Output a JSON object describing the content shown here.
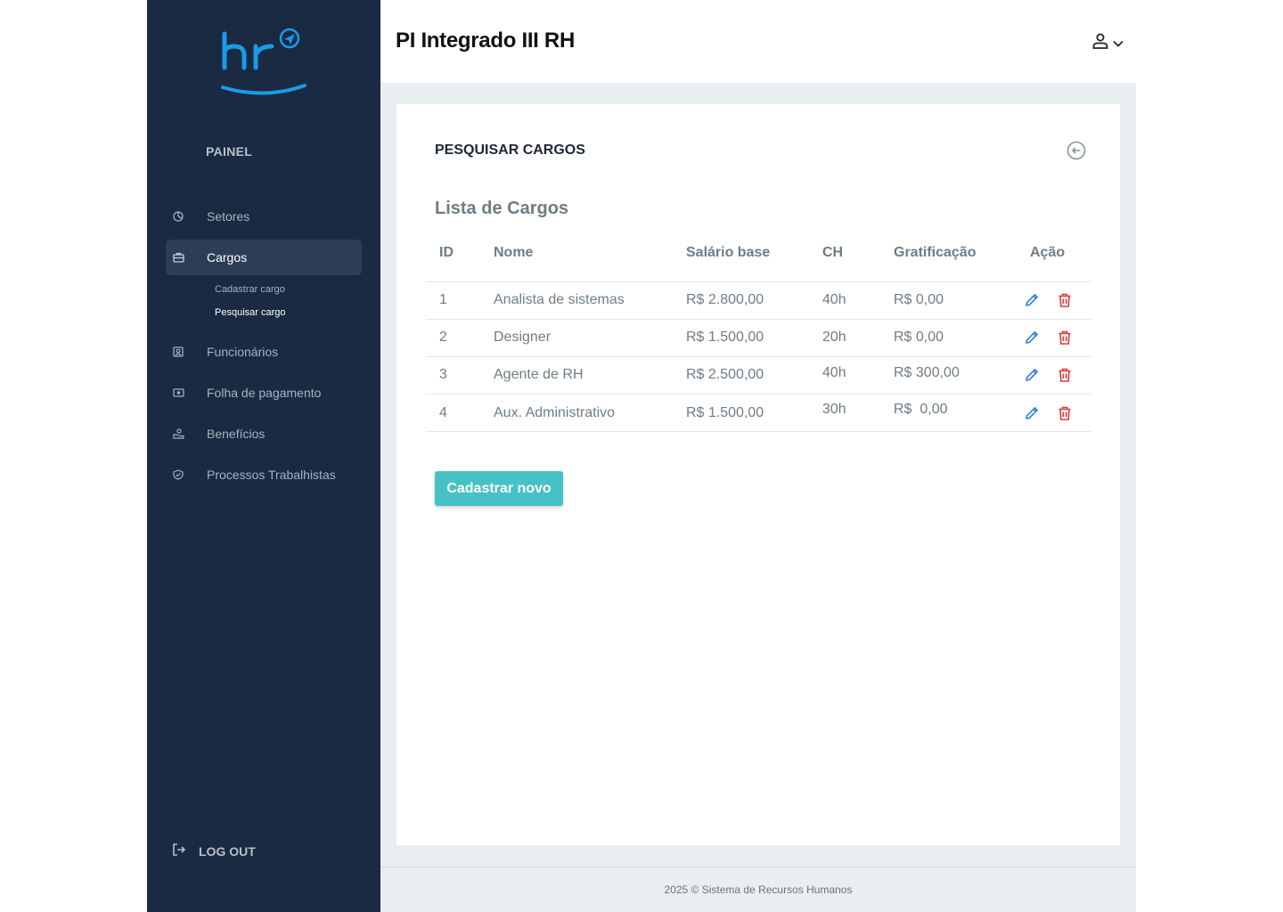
{
  "app": {
    "title": "PI Integrado III RH",
    "accent_color": "#46c1c6",
    "sidebar_color": "#1a2a42"
  },
  "sidebar": {
    "section_label": "PAINEL",
    "items": [
      {
        "label": "Setores",
        "icon": "pie-chart-icon"
      },
      {
        "label": "Cargos",
        "icon": "briefcase-icon",
        "active": true
      },
      {
        "label": "Funcionários",
        "icon": "id-badge-icon"
      },
      {
        "label": "Folha de pagamento",
        "icon": "money-icon"
      },
      {
        "label": "Benefícios",
        "icon": "hand-coins-icon"
      },
      {
        "label": "Processos Trabalhistas",
        "icon": "shield-check-icon"
      }
    ],
    "subitems": [
      {
        "label": "Cadastrar cargo"
      },
      {
        "label": "Pesquisar cargo",
        "current": true
      }
    ],
    "logout_label": "LOG OUT"
  },
  "page": {
    "heading": "PESQUISAR CARGOS",
    "list_title": "Lista de Cargos",
    "columns": [
      "ID",
      "Nome",
      "Salário base",
      "CH",
      "Gratificação",
      "Ação"
    ],
    "rows": [
      {
        "id": "1",
        "nome": "Analista de sistemas",
        "salario": "R$ 2.800,00",
        "ch": "40h",
        "gratificacao": "R$ 0,00"
      },
      {
        "id": "2",
        "nome": "Designer",
        "salario": "R$ 1.500,00",
        "ch": "20h",
        "gratificacao": "R$ 0,00"
      },
      {
        "id": "3",
        "nome": "Agente de RH",
        "salario": "R$ 2.500,00",
        "ch": "40h",
        "gratificacao": "R$ 300,00"
      },
      {
        "id": "4",
        "nome": "Aux. Administrativo",
        "salario": "R$ 1.500,00",
        "ch": "30h",
        "gratificacao": "R$  0,00"
      }
    ],
    "new_button_label": "Cadastrar novo"
  },
  "footer": {
    "text": "2025 © Sistema de Recursos Humanos"
  }
}
